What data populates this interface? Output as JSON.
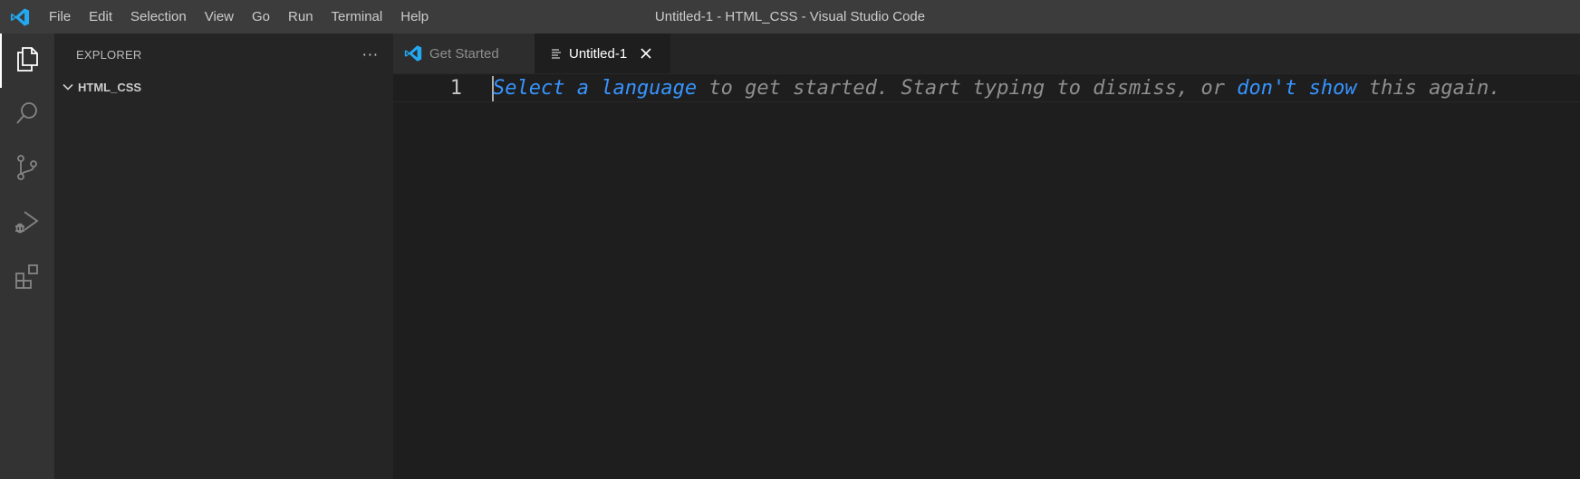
{
  "titlebar": {
    "menu": [
      "File",
      "Edit",
      "Selection",
      "View",
      "Go",
      "Run",
      "Terminal",
      "Help"
    ],
    "window_title": "Untitled-1 - HTML_CSS - Visual Studio Code"
  },
  "activity_bar": {
    "items": [
      "files-icon",
      "search-icon",
      "source-control-icon",
      "run-debug-icon",
      "extensions-icon"
    ],
    "active": "files-icon"
  },
  "sidebar": {
    "title": "EXPLORER",
    "more": "···",
    "folder": "HTML_CSS"
  },
  "tabs": [
    {
      "label": "Get Started",
      "active": false
    },
    {
      "label": "Untitled-1",
      "active": true
    }
  ],
  "editor": {
    "line_number": "1",
    "hint": {
      "link1": "Select a language",
      "text1": " to get started. Start typing to dismiss, or ",
      "link2": "don't show",
      "text2": " this again."
    }
  },
  "colors": {
    "accent": "#3794ff",
    "vscode_blue": "#23a9f2"
  }
}
